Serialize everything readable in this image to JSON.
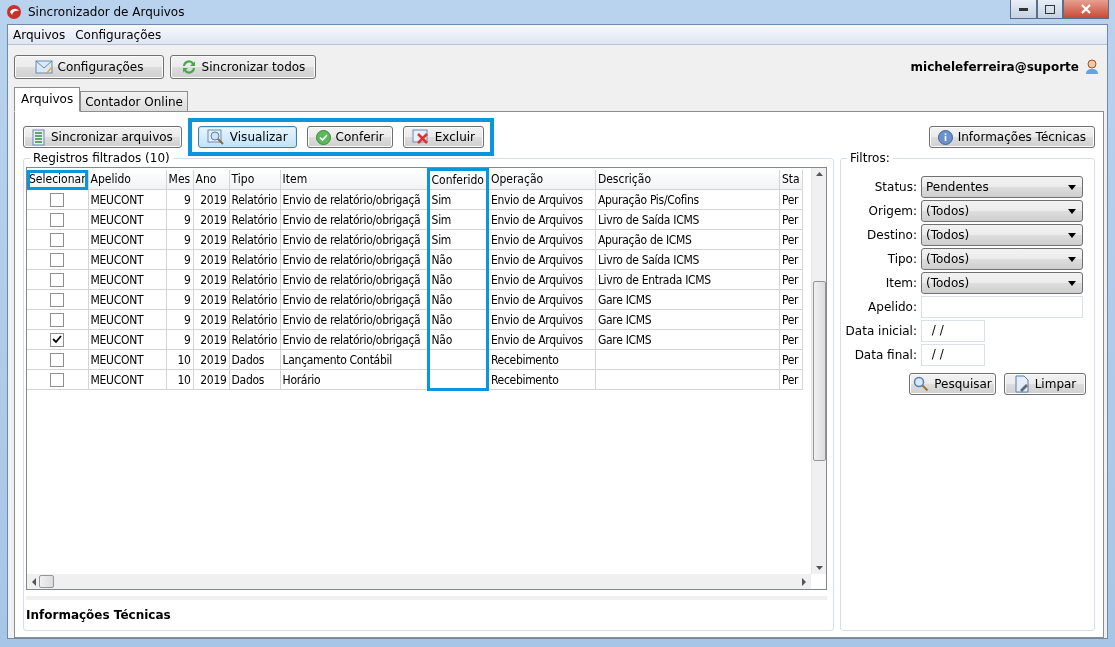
{
  "window": {
    "title": "Sincronizador de Arquivos"
  },
  "menu": [
    "Arquivos",
    "Configurações"
  ],
  "top_buttons": [
    "Configurações",
    "Sincronizar todos"
  ],
  "user": "micheleferreira@suporte",
  "tabs": [
    {
      "label": "Arquivos",
      "selected": true
    },
    {
      "label": "Contador Online",
      "selected": false
    }
  ],
  "sync_button": "Sincronizar arquivos",
  "action_group": {
    "framed": true,
    "buttons": [
      {
        "label": "Visualizar",
        "focused": true
      },
      {
        "label": "Conferir",
        "focused": false
      },
      {
        "label": "Excluir",
        "focused": false
      }
    ]
  },
  "info_button": "Informações Técnicas",
  "records": {
    "title": "Registros filtrados (10)",
    "columns": [
      {
        "label": "Selecionar",
        "header_framed": true
      },
      {
        "label": "Apelido"
      },
      {
        "label": "Mes"
      },
      {
        "label": "Ano"
      },
      {
        "label": "Tipo"
      },
      {
        "label": "Item"
      },
      {
        "label": "Conferido",
        "column_framed": true
      },
      {
        "label": "Operação"
      },
      {
        "label": "Descrição"
      },
      {
        "label": "Sta"
      }
    ],
    "rows": [
      {
        "checked": false,
        "cells": [
          "",
          "MEUCONT",
          "9",
          "2019",
          "Relatório",
          "Envio de relatório/obrigaçã",
          "Sim",
          "Envio de Arquivos",
          "Apuração Pis/Cofins",
          "Per"
        ]
      },
      {
        "checked": false,
        "cells": [
          "",
          "MEUCONT",
          "9",
          "2019",
          "Relatório",
          "Envio de relatório/obrigaçã",
          "Sim",
          "Envio de Arquivos",
          "Livro de Saída ICMS",
          "Per"
        ]
      },
      {
        "checked": false,
        "cells": [
          "",
          "MEUCONT",
          "9",
          "2019",
          "Relatório",
          "Envio de relatório/obrigaçã",
          "Sim",
          "Envio de Arquivos",
          "Apuração de ICMS",
          "Per"
        ]
      },
      {
        "checked": false,
        "cells": [
          "",
          "MEUCONT",
          "9",
          "2019",
          "Relatório",
          "Envio de relatório/obrigaçã",
          "Não",
          "Envio de Arquivos",
          "Livro de Saída ICMS",
          "Per"
        ]
      },
      {
        "checked": false,
        "cells": [
          "",
          "MEUCONT",
          "9",
          "2019",
          "Relatório",
          "Envio de relatório/obrigaçã",
          "Não",
          "Envio de Arquivos",
          "Livro de Entrada ICMS",
          "Per"
        ]
      },
      {
        "checked": false,
        "cells": [
          "",
          "MEUCONT",
          "9",
          "2019",
          "Relatório",
          "Envio de relatório/obrigaçã",
          "Não",
          "Envio de Arquivos",
          "Gare ICMS",
          "Per"
        ]
      },
      {
        "checked": false,
        "cells": [
          "",
          "MEUCONT",
          "9",
          "2019",
          "Relatório",
          "Envio de relatório/obrigaçã",
          "Não",
          "Envio de Arquivos",
          "Gare ICMS",
          "Per"
        ]
      },
      {
        "checked": true,
        "cells": [
          "",
          "MEUCONT",
          "9",
          "2019",
          "Relatório",
          "Envio de relatório/obrigaçã",
          "Não",
          "Envio de Arquivos",
          "Gare ICMS",
          "Per"
        ]
      },
      {
        "checked": false,
        "cells": [
          "",
          "MEUCONT",
          "10",
          "2019",
          "Dados",
          "Lançamento Contábil",
          "",
          "Recebimento",
          "",
          "Per"
        ]
      },
      {
        "checked": false,
        "cells": [
          "",
          "MEUCONT",
          "10",
          "2019",
          "Dados",
          "Horário",
          "",
          "Recebimento",
          "",
          "Per"
        ]
      }
    ]
  },
  "filters": {
    "title": "Filtros:",
    "fields": [
      {
        "label": "Status:",
        "kind": "select",
        "value": "Pendentes"
      },
      {
        "label": "Origem:",
        "kind": "select",
        "value": "(Todos)"
      },
      {
        "label": "Destino:",
        "kind": "select",
        "value": "(Todos)"
      },
      {
        "label": "Tipo:",
        "kind": "select",
        "value": "(Todos)"
      },
      {
        "label": "Item:",
        "kind": "select",
        "value": "(Todos)"
      },
      {
        "label": "Apelido:",
        "kind": "text"
      },
      {
        "label": "Data inicial:",
        "kind": "date",
        "value": " / /"
      },
      {
        "label": "Data final:",
        "kind": "date",
        "value": " / /"
      }
    ],
    "buttons": [
      "Pesquisar",
      "Limpar"
    ]
  },
  "footer": "Informações Técnicas"
}
